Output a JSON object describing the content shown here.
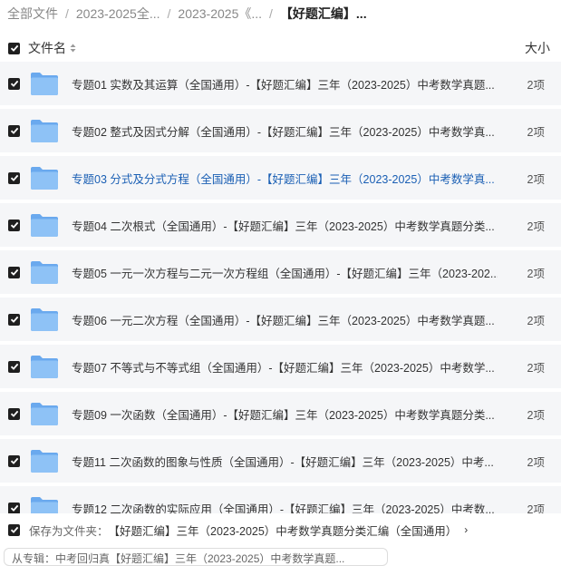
{
  "breadcrumb": {
    "items": [
      "全部文件",
      "2023-2025全...",
      "2023-2025《...",
      "【好题汇编】..."
    ]
  },
  "header": {
    "name_label": "文件名",
    "size_label": "大小"
  },
  "rows": [
    {
      "name": "专题01 实数及其运算（全国通用）-【好题汇编】三年（2023-2025）中考数学真题...",
      "size": "2项"
    },
    {
      "name": "专题02 整式及因式分解（全国通用）-【好题汇编】三年（2023-2025）中考数学真...",
      "size": "2项"
    },
    {
      "name": "专题03 分式及分式方程（全国通用）-【好题汇编】三年（2023-2025）中考数学真...",
      "size": "2项"
    },
    {
      "name": "专题04 二次根式（全国通用）-【好题汇编】三年（2023-2025）中考数学真题分类...",
      "size": "2项"
    },
    {
      "name": "专题05 一元一次方程与二元一次方程组（全国通用）-【好题汇编】三年（2023-202...",
      "size": "2项"
    },
    {
      "name": "专题06 一元二次方程（全国通用）-【好题汇编】三年（2023-2025）中考数学真题...",
      "size": "2项"
    },
    {
      "name": "专题07 不等式与不等式组（全国通用）-【好题汇编】三年（2023-2025）中考数学...",
      "size": "2项"
    },
    {
      "name": "专题09 一次函数（全国通用）-【好题汇编】三年（2023-2025）中考数学真题分类...",
      "size": "2项"
    },
    {
      "name": "专题11 二次函数的图象与性质（全国通用）-【好题汇编】三年（2023-2025）中考...",
      "size": "2项"
    },
    {
      "name": "专题12 二次函数的实际应用（全国通用）-【好题汇编】三年（2023-2025）中考数...",
      "size": "2项"
    }
  ],
  "save_bar": {
    "label": "保存为文件夹：",
    "path": "【好题汇编】三年（2023-2025）中考数学真题分类汇编（全国通用）",
    "chevron": "›"
  },
  "bottom": {
    "text": "从专辑：中考回归真【好题汇编】三年（2023-2025）中考数学真题..."
  },
  "colors": {
    "row_bg": "#f5f6f8",
    "folder": "#7fb6f2",
    "link": "#1a5fb4",
    "checkbox": "#1f1f1f"
  }
}
